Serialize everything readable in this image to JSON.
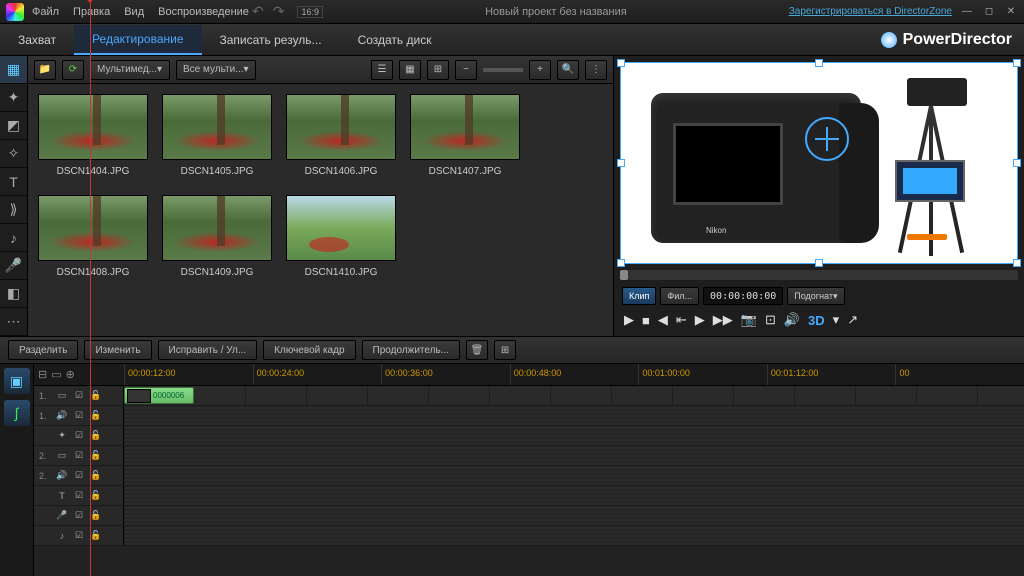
{
  "titlebar": {
    "menu": [
      "Файл",
      "Правка",
      "Вид",
      "Воспроизведение"
    ],
    "ratio": "16:9",
    "project": "Новый проект без названия",
    "register_link": "Зарегистрироваться в DirectorZone"
  },
  "brand": "PowerDirector",
  "tabs": {
    "capture": "Захват",
    "edit": "Редактирование",
    "produce": "Записать резуль...",
    "disc": "Создать диск"
  },
  "library": {
    "sort1": "Мультимед...",
    "sort2": "Все мульти...",
    "thumbs": [
      {
        "label": "DSCN1404.JPG",
        "cls": "garden"
      },
      {
        "label": "DSCN1405.JPG",
        "cls": "garden"
      },
      {
        "label": "DSCN1406.JPG",
        "cls": "garden"
      },
      {
        "label": "DSCN1407.JPG",
        "cls": "garden"
      },
      {
        "label": "DSCN1408.JPG",
        "cls": "garden"
      },
      {
        "label": "DSCN1409.JPG",
        "cls": "garden"
      },
      {
        "label": "DSCN1410.JPG",
        "cls": "field"
      }
    ]
  },
  "preview": {
    "camera_brand": "Nikon",
    "mode_clip": "Клип",
    "mode_film": "Фил...",
    "timecode": "00:00:00:00",
    "fit": "Подогнат",
    "threeD": "3D"
  },
  "timeline_toolbar": {
    "split": "Разделить",
    "modify": "Изменить",
    "fix": "Исправить / Ул...",
    "keyframe": "Ключевой кадр",
    "duration": "Продолжитель..."
  },
  "ruler": [
    "00:00:12:00",
    "00:00:24:00",
    "00:00:36:00",
    "00:00:48:00",
    "00:01:00:00",
    "00:01:12:00",
    "00"
  ],
  "clip_label": "0000006",
  "tracks": [
    {
      "num": "1.",
      "type": "video",
      "dashed": false,
      "hasclip": true
    },
    {
      "num": "1.",
      "type": "audio",
      "dashed": true,
      "hasclip": false
    },
    {
      "num": "",
      "type": "fx",
      "dashed": true,
      "hasclip": false
    },
    {
      "num": "2.",
      "type": "video",
      "dashed": true,
      "hasclip": false
    },
    {
      "num": "2.",
      "type": "audio",
      "dashed": true,
      "hasclip": false
    },
    {
      "num": "",
      "type": "title",
      "dashed": true,
      "hasclip": false
    },
    {
      "num": "",
      "type": "mic",
      "dashed": true,
      "hasclip": false
    },
    {
      "num": "",
      "type": "music",
      "dashed": true,
      "hasclip": false
    }
  ]
}
